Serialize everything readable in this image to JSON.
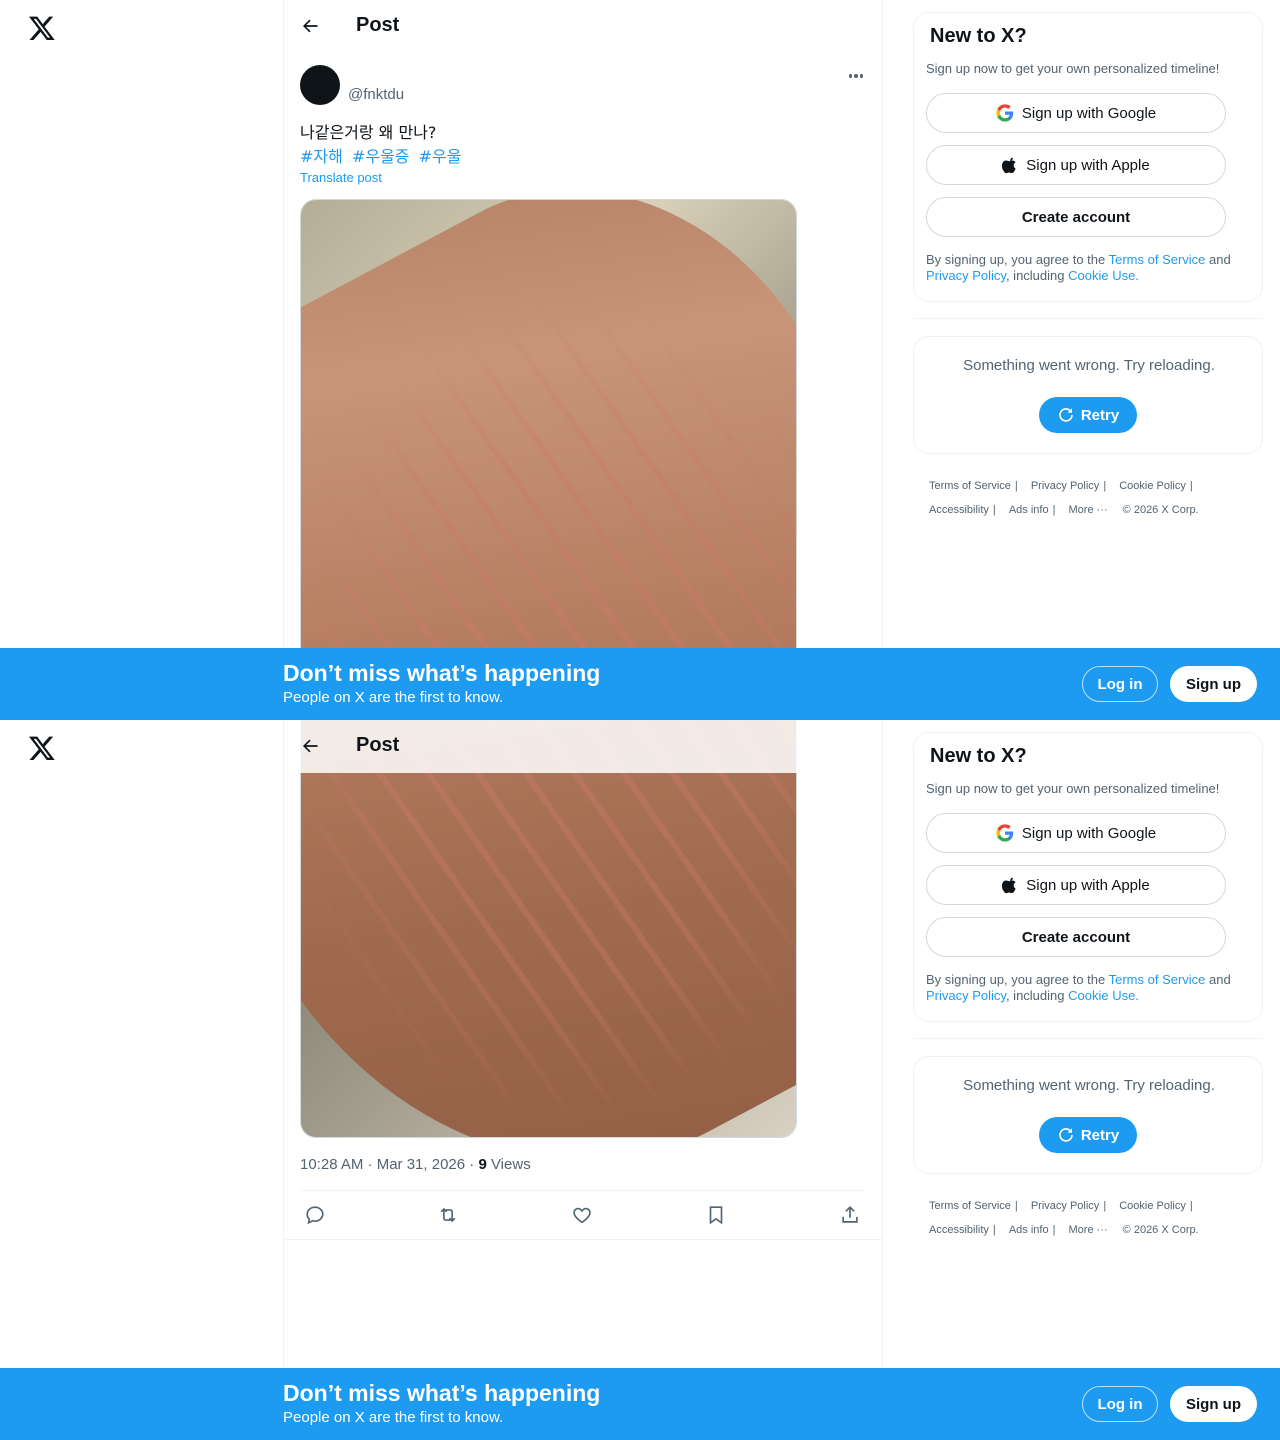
{
  "nav": {
    "logo": "x-logo"
  },
  "header": {
    "title": "Post"
  },
  "post": {
    "handle": "@fnktdu",
    "text": "나같은거랑 왜 만나?",
    "hashtags": [
      "#자해",
      "#우울증",
      "#우울"
    ],
    "translate": "Translate post",
    "time": "10:28 AM · Mar 31, 2026 · ",
    "views_count": "9",
    "views_label": " Views"
  },
  "signup": {
    "title": "New to X?",
    "subtitle": "Sign up now to get your own personalized timeline!",
    "google": "Sign up with Google",
    "apple": "Sign up with Apple",
    "create": "Create account",
    "legal_1": "By signing up, you agree to the ",
    "terms": "Terms of Service",
    "legal_2": " and ",
    "privacy": "Privacy Policy",
    "legal_3": ", including ",
    "cookie": "Cookie Use."
  },
  "error": {
    "message": "Something went wrong. Try reloading.",
    "retry": "Retry"
  },
  "footer": {
    "links": [
      "Terms of Service",
      "Privacy Policy",
      "Cookie Policy",
      "Accessibility",
      "Ads info",
      "More ···",
      "© 2026 X Corp."
    ]
  },
  "banner": {
    "title": "Don’t miss what’s happening",
    "subtitle": "People on X are the first to know.",
    "login": "Log in",
    "signup": "Sign up"
  },
  "colors": {
    "accent": "#1d9bf0",
    "text": "#0f1419",
    "muted": "#536471"
  }
}
